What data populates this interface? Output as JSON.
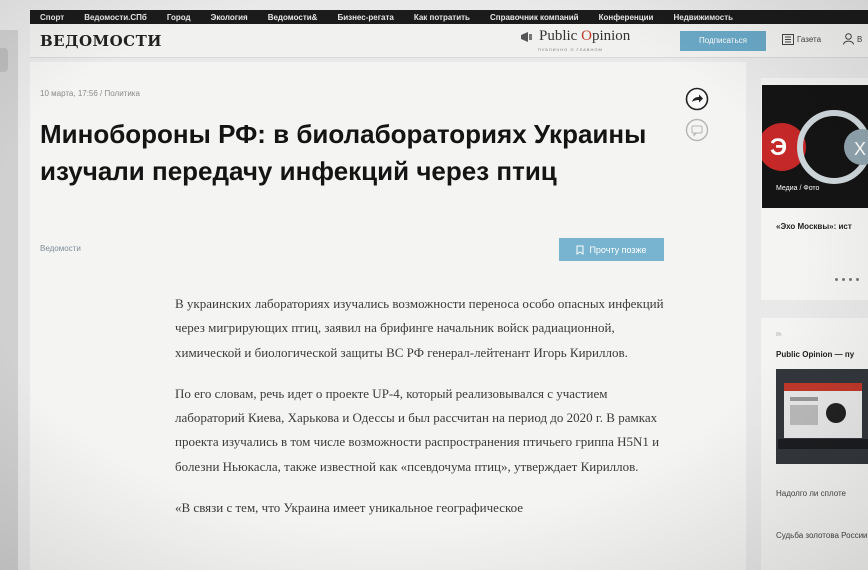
{
  "nav": {
    "items": [
      "Спорт",
      "Ведомости.СПб",
      "Город",
      "Экология",
      "Ведомости&",
      "Бизнес-регата",
      "Как потратить",
      "Справочник компаний",
      "Конференции",
      "Недвижимость"
    ]
  },
  "header": {
    "logo": "ВЕДОМОСТИ",
    "partner_a": "Public ",
    "partner_b": "O",
    "partner_c": "pinion",
    "partner_sub": "ПУБЛИЧНО О ГЛАВНОМ",
    "subscribe_label": "Подписаться",
    "newspaper_label": "Газета",
    "user_label": "В"
  },
  "article": {
    "meta": "10 марта, 17:56 / Политика",
    "title": "Минобороны РФ: в биолабораториях Украины изучали передачу инфекций через птиц",
    "source": "Ведомости",
    "read_later_label": "Прочту позже",
    "paragraphs": [
      "В украинских лабораториях изучались возможности переноса особо опасных инфекций через мигрирующих птиц, заявил на брифинге начальник войск радиационной, химической и биологической защиты ВС РФ генерал-лейтенант Игорь Кириллов.",
      "По его словам, речь идет о проекте UP-4, который реализовывался с участием лабораторий Киева, Харькова и Одессы и был рассчитан на период до 2020 г. В рамках проекта изучались в том числе возможности распространения птичьего гриппа H5N1 и болезни Ньюкасла, также известной как «псевдочума птиц», утверждает Кириллов.",
      "«В связи с тем, что Украина имеет уникальное географическое"
    ]
  },
  "sidebar": {
    "card1_caption": "Медиа / Фото",
    "card1_text": "«Эхо Москвы»: ист",
    "card2_small": "8h",
    "card2_title": "Public Opinion — пу",
    "card2_text1": "Надолго ли сплоте",
    "card2_text2": "Судьба золотова России"
  },
  "colors": {
    "accent": "#6aa9c7",
    "nav_bg": "#1b1b1b",
    "partner_o": "#c03a2b"
  }
}
